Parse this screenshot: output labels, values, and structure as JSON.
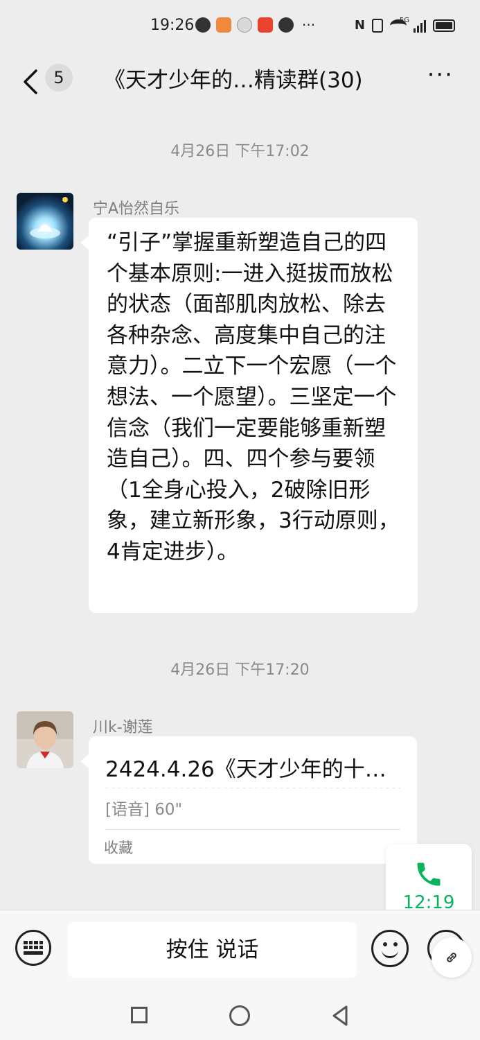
{
  "status_bar": {
    "time": "19:26",
    "more_indicator": "···",
    "nfc": "N",
    "network_label": "5G",
    "icons": [
      "wechat-icon",
      "orange-app-icon",
      "moon-icon",
      "red-app-icon",
      "wechat-icon",
      "nfc-icon",
      "vibrate-icon",
      "wifi-icon",
      "signal-icon",
      "battery-icon"
    ]
  },
  "header": {
    "back_icon": "chevron-left-icon",
    "unread_count": "5",
    "title": "《天才少年的…精读群(30)",
    "more_icon": "more-icon",
    "more_label": "···"
  },
  "messages": [
    {
      "timestamp": "4月26日 下午17:02",
      "sender": "宁A怡然自乐",
      "type": "text",
      "text": "“引子”掌握重新塑造自己的四个基本原则:一进入挺拔而放松的状态（面部肌肉放松、除去各种杂念、高度集中自己的注意力）。二立下一个宏愿（一个想法、一个愿望）。三坚定一个信念（我们一定要能够重新塑造自己）。四、四个参与要领（1全身心投入，2破除旧形象，建立新形象，3行动原则，4肯定进步）。"
    },
    {
      "timestamp": "4月26日 下午17:20",
      "sender": "川k-谢莲",
      "type": "favorite_card",
      "card_title": "2424.4.26《天才少年的十…",
      "card_meta": "[语音] 60\"",
      "card_source": "收藏"
    }
  ],
  "floating_call": {
    "icon": "phone-icon",
    "duration": "12:19",
    "color": "#07b35c"
  },
  "input_bar": {
    "keyboard_icon": "keyboard-icon",
    "hold_to_talk": "按住 说话",
    "emoji_icon": "emoji-icon",
    "plus_icon": "plus-icon",
    "link_icon": "link-icon"
  },
  "nav_bar": {
    "icons": [
      "nav-recent-icon",
      "nav-home-icon",
      "nav-back-icon"
    ]
  },
  "colors": {
    "background": "#ededed",
    "bubble": "#ffffff",
    "accent_green": "#07b35c"
  }
}
